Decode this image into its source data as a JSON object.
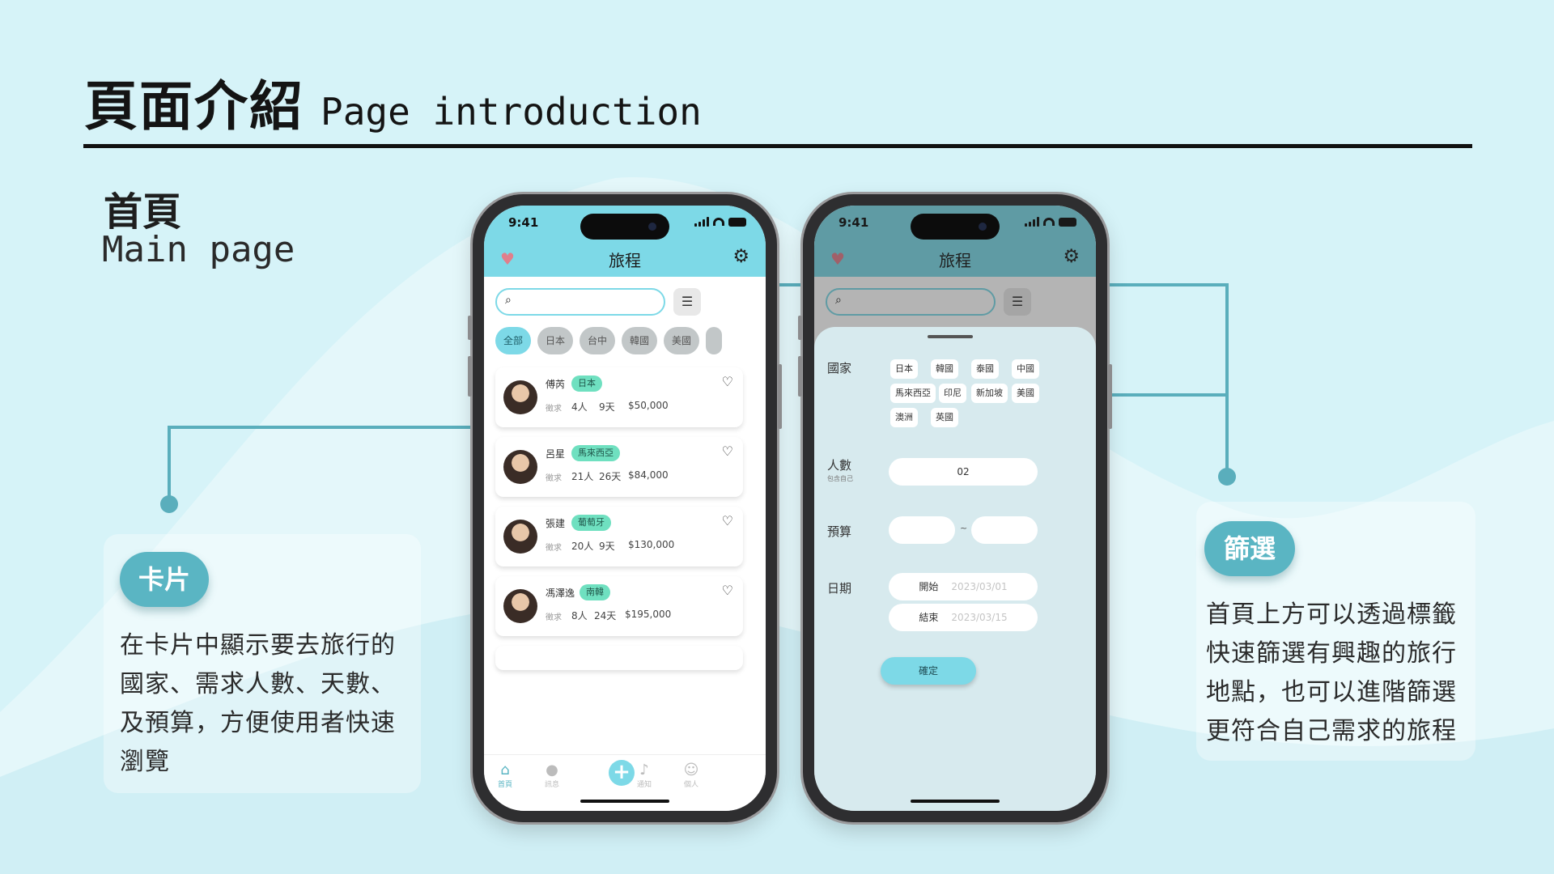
{
  "slide": {
    "title_zh": "頁面介紹",
    "title_en": "Page introduction",
    "section_zh": "首頁",
    "section_en": "Main page"
  },
  "callouts": {
    "left": {
      "pill": "卡片",
      "lines": [
        "在卡片中顯示要去旅行的",
        "國家、需求人數、天數、",
        "及預算，方便使用者快速",
        "瀏覽"
      ]
    },
    "right": {
      "pill": "篩選",
      "lines": [
        "首頁上方可以透過標籤",
        "快速篩選有興趣的旅行",
        "地點，也可以進階篩選",
        "更符合自己需求的旅程"
      ]
    }
  },
  "phone": {
    "time": "9:41",
    "app_title": "旅程",
    "icons": {
      "favorite": "heart-icon",
      "settings": "gear-icon",
      "search": "search-icon",
      "filter": "filter-icon"
    },
    "tags": [
      "全部",
      "日本",
      "台中",
      "韓國",
      "美國"
    ],
    "cards": [
      {
        "name": "傅芮",
        "country": "日本",
        "label": "徵求",
        "people": "4人",
        "days": "9天",
        "budget": "$50,000"
      },
      {
        "name": "呂星",
        "country": "馬來西亞",
        "label": "徵求",
        "people": "21人",
        "days": "26天",
        "budget": "$84,000"
      },
      {
        "name": "張建",
        "country": "葡萄牙",
        "label": "徵求",
        "people": "20人",
        "days": "9天",
        "budget": "$130,000"
      },
      {
        "name": "馮澤逸",
        "country": "南韓",
        "label": "徵求",
        "people": "8人",
        "days": "24天",
        "budget": "$195,000"
      }
    ],
    "tabbar": [
      "首頁",
      "訊息",
      "通知",
      "個人"
    ]
  },
  "filter_sheet": {
    "country_label": "國家",
    "countries": [
      "日本",
      "韓國",
      "泰國",
      "中國",
      "馬來西亞",
      "印尼",
      "新加坡",
      "美國",
      "澳洲",
      "英國"
    ],
    "people_label": "人數",
    "people_sub": "包含自己",
    "people_value": "02",
    "budget_label": "預算",
    "budget_sep": "~",
    "date_label": "日期",
    "start_label": "開始",
    "start_placeholder": "2023/03/01",
    "end_label": "結束",
    "end_placeholder": "2023/03/15",
    "confirm": "確定"
  },
  "colors": {
    "accent": "#7dd9e7",
    "connector": "#5aaebc",
    "badge": "#6fe0c0",
    "pill": "#5ab5c3"
  }
}
